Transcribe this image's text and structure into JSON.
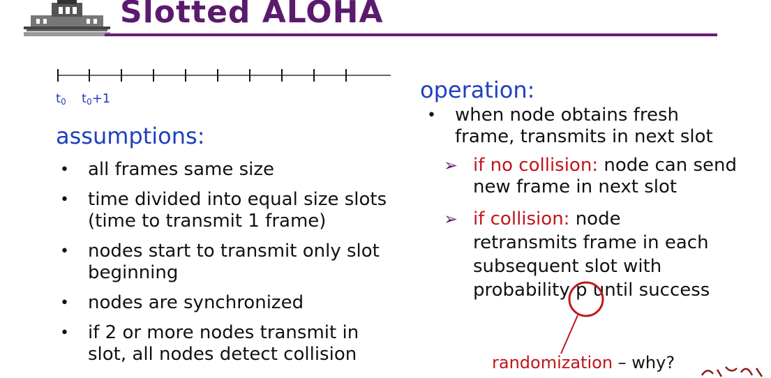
{
  "title": "Slotted ALOHA",
  "timeline": {
    "label_t0_base": "t",
    "label_t0_sub": "0",
    "label_t1_base": "t",
    "label_t1_sub": "0",
    "label_t1_suffix": "+1"
  },
  "assumptions": {
    "heading": "assumptions",
    "heading_colon": ":",
    "items": [
      {
        "lines": [
          "all frames same size"
        ]
      },
      {
        "lines": [
          "time divided into equal size slots",
          "(time to transmit 1 frame)"
        ]
      },
      {
        "lines": [
          "nodes start to transmit only slot",
          "beginning"
        ]
      },
      {
        "lines": [
          "nodes are synchronized"
        ]
      },
      {
        "lines": [
          "if 2 or more nodes transmit in",
          "slot, all nodes detect collision"
        ]
      }
    ]
  },
  "operation": {
    "heading": "operation:",
    "item1_line1": "when node obtains fresh",
    "item1_line2": "frame, transmits in next slot",
    "sub1_red": "if no collision:",
    "sub1_rest": " node can send",
    "sub1_line2": "new frame in next slot",
    "sub2_red": "if collision:",
    "sub2_rest": " node",
    "sub2_line2": "retransmits frame in each",
    "sub2_line3": "subsequent slot with",
    "sub2_line4_a": "probability ",
    "sub2_line4_p": "p",
    "sub2_line4_b": " until success"
  },
  "annotation": {
    "red": "randomization",
    "rest": " – why?"
  },
  "bullet_glyph": "•",
  "arrow_glyph": "➢",
  "colors": {
    "title": "#5b1a6e",
    "heading": "#1f3fbf",
    "emphasis": "#c0161c",
    "body": "#111111"
  }
}
